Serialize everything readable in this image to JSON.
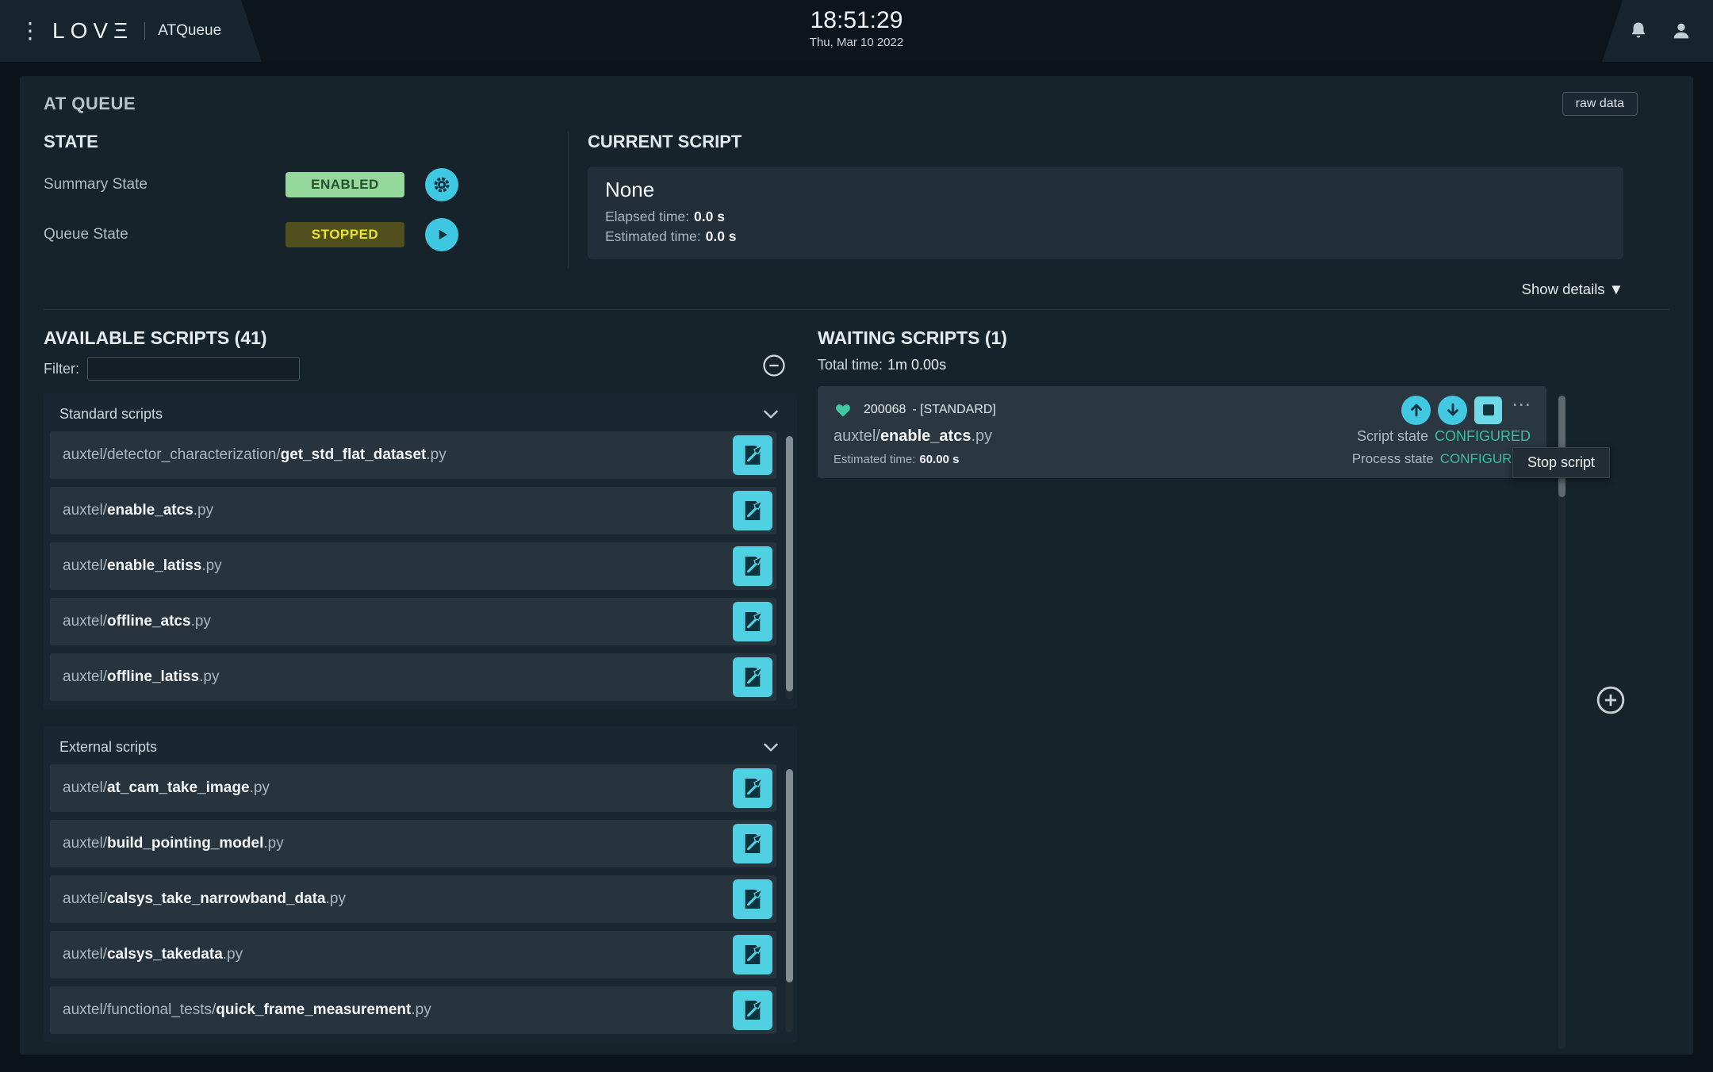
{
  "colors": {
    "accent_cyan": "#4fd0e3",
    "enabled_badge_bg": "#95d89b",
    "stopped_badge_bg": "#514f1e",
    "stopped_badge_text": "#e8e32f",
    "configured_state_text": "#3cbf9a"
  },
  "header": {
    "menu_glyph": "⋮",
    "logo": "LOVΞ",
    "app_name": "ATQueue",
    "time": "18:51:29",
    "date": "Thu, Mar 10 2022"
  },
  "panel": {
    "title": "AT QUEUE",
    "raw_data_button": "raw data",
    "show_details": "Show details ▼"
  },
  "state": {
    "title": "STATE",
    "summary_label": "Summary State",
    "summary_value": "ENABLED",
    "queue_label": "Queue State",
    "queue_value": "STOPPED"
  },
  "current_script": {
    "title": "CURRENT SCRIPT",
    "name": "None",
    "elapsed_label": "Elapsed time:",
    "elapsed_value": "0.0 s",
    "estimated_label": "Estimated time:",
    "estimated_value": "0.0 s"
  },
  "available": {
    "title": "AVAILABLE SCRIPTS (41)",
    "filter_label": "Filter:",
    "filter_value": "",
    "groups": [
      {
        "label": "Standard scripts",
        "scripts": [
          {
            "prefix": "auxtel/detector_characterization/",
            "name": "get_std_flat_dataset",
            "ext": ".py"
          },
          {
            "prefix": "auxtel/",
            "name": "enable_atcs",
            "ext": ".py"
          },
          {
            "prefix": "auxtel/",
            "name": "enable_latiss",
            "ext": ".py"
          },
          {
            "prefix": "auxtel/",
            "name": "offline_atcs",
            "ext": ".py"
          },
          {
            "prefix": "auxtel/",
            "name": "offline_latiss",
            "ext": ".py"
          }
        ]
      },
      {
        "label": "External scripts",
        "scripts": [
          {
            "prefix": "auxtel/",
            "name": "at_cam_take_image",
            "ext": ".py"
          },
          {
            "prefix": "auxtel/",
            "name": "build_pointing_model",
            "ext": ".py"
          },
          {
            "prefix": "auxtel/",
            "name": "calsys_take_narrowband_data",
            "ext": ".py"
          },
          {
            "prefix": "auxtel/",
            "name": "calsys_takedata",
            "ext": ".py"
          },
          {
            "prefix": "auxtel/functional_tests/",
            "name": "quick_frame_measurement",
            "ext": ".py"
          }
        ]
      }
    ]
  },
  "waiting": {
    "title": "WAITING SCRIPTS (1)",
    "total_label": "Total time:",
    "total_value": "1m 0.00s",
    "card": {
      "id": "200068",
      "suffix": "- [STANDARD]",
      "prefix": "auxtel/",
      "name": "enable_atcs",
      "ext": ".py",
      "estimated_label": "Estimated time:",
      "estimated_value": "60.00 s",
      "script_state_label": "Script state",
      "script_state_value": "CONFIGURED",
      "process_state_label": "Process state",
      "process_state_value": "CONFIGURED",
      "more_glyph": "⋯"
    },
    "tooltip": "Stop script"
  }
}
